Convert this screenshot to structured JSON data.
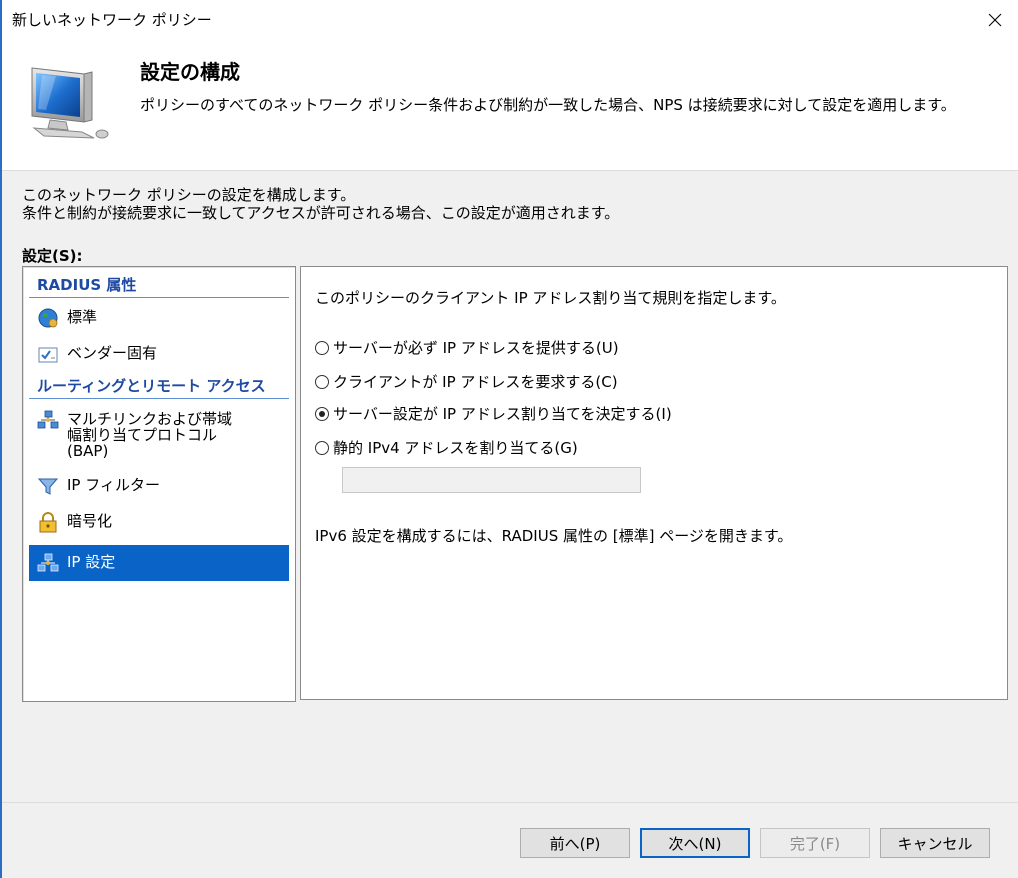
{
  "window": {
    "title": "新しいネットワーク ポリシー"
  },
  "header": {
    "title": "設定の構成",
    "description": "ポリシーのすべてのネットワーク ポリシー条件および制約が一致した場合、NPS は接続要求に対して設定を適用します。"
  },
  "intro": {
    "line1": "このネットワーク ポリシーの設定を構成します。",
    "line2": "条件と制約が接続要求に一致してアクセスが許可される場合、この設定が適用されます。"
  },
  "settings_label": "設定(S):",
  "sidebar": {
    "categories": [
      {
        "label": "RADIUS 属性"
      },
      {
        "label": "ルーティングとリモート アクセス"
      }
    ],
    "items": [
      {
        "label": "標準",
        "icon": "globe-icon"
      },
      {
        "label": "ベンダー固有",
        "icon": "checkbox-list-icon"
      },
      {
        "label": "マルチリンクおよび帯域\n幅割り当てプロトコル\n(BAP)",
        "icon": "network-icon"
      },
      {
        "label": "IP フィルター",
        "icon": "filter-icon"
      },
      {
        "label": "暗号化",
        "icon": "lock-icon"
      },
      {
        "label": "IP 設定",
        "icon": "network-icon",
        "selected": true
      }
    ]
  },
  "main": {
    "heading": "このポリシーのクライアント IP アドレス割り当て規則を指定します。",
    "options": [
      {
        "label": "サーバーが必ず IP アドレスを提供する(U)",
        "checked": false
      },
      {
        "label": "クライアントが IP アドレスを要求する(C)",
        "checked": false
      },
      {
        "label": "サーバー設定が IP アドレス割り当てを決定する(I)",
        "checked": true
      },
      {
        "label": "静的 IPv4 アドレスを割り当てる(G)",
        "checked": false
      }
    ],
    "static_ip_value": "",
    "ipv6_note": "IPv6 設定を構成するには、RADIUS 属性の [標準] ページを開きます。"
  },
  "footer": {
    "prev_label": "前へ(P)",
    "next_label": "次へ(N)",
    "finish_label": "完了(F)",
    "cancel_label": "キャンセル"
  },
  "colors": {
    "selection": "#0a64c8",
    "category_text": "#1f4aa3"
  }
}
